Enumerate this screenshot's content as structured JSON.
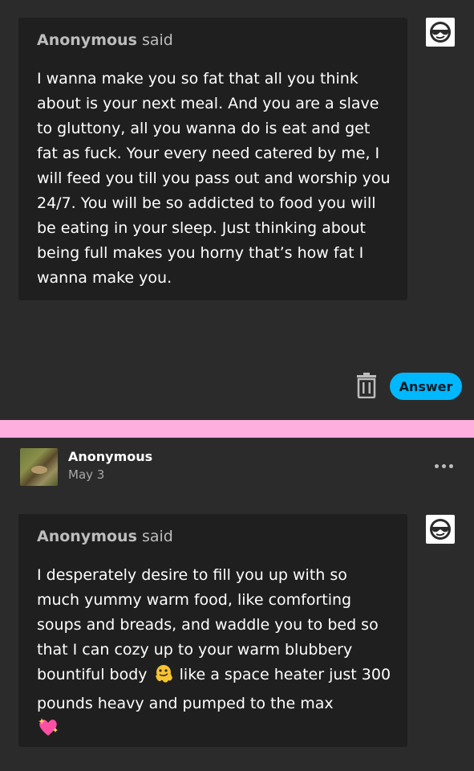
{
  "ask1": {
    "asker": "Anonymous",
    "said": "said",
    "text": "I wanna make you so fat that all you think about is your next meal. And you are a slave to gluttony, all you wanna do is eat and get fat as fuck. Your every need catered by me, I will feed you till you pass out and worship you 24/7. You will be so addicted to food you will be eating in your sleep. Just thinking about being full makes you horny that’s how fat I wanna make you."
  },
  "actions": {
    "answer_label": "Answer",
    "delete_icon": "trash-icon"
  },
  "divider": {
    "color": "#ffafde"
  },
  "post": {
    "author": "Anonymous",
    "date": "May 3",
    "menu_icon": "more-dots-icon"
  },
  "ask2": {
    "asker": "Anonymous",
    "said": "said",
    "text_part1": "I desperately desire to fill you up with so much yummy warm food, like comforting soups and breads, and waddle you to bed so that I can cozy up to your warm blubbery bountiful body",
    "emoji1": "melting-face-emoji",
    "text_part2": "like a space heater just 300 pounds heavy and pumped to the max",
    "emoji2": "sparkling-heart-emoji"
  },
  "colors": {
    "background": "#2b2b2b",
    "card": "#1f1f1f",
    "answer_button": "#00b8ff"
  }
}
